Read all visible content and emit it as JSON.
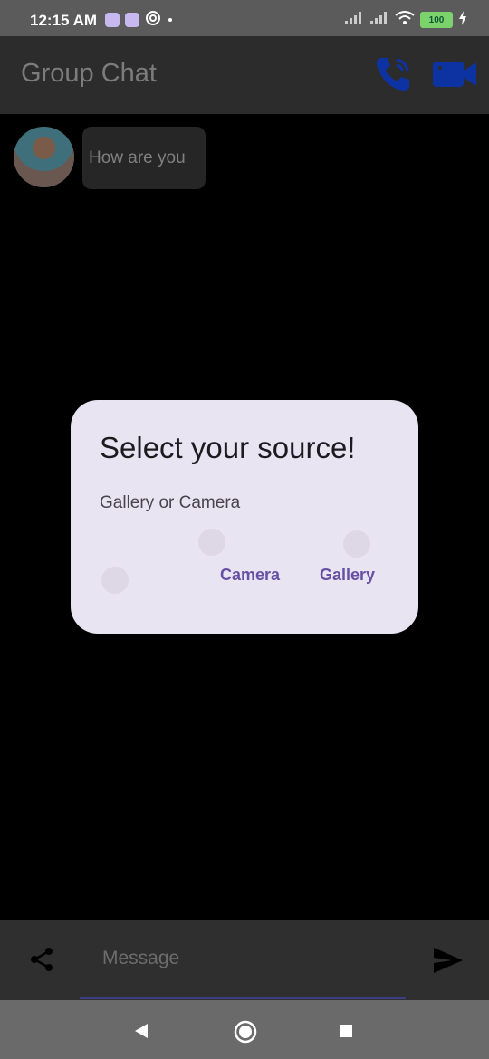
{
  "status_bar": {
    "time": "12:15 AM",
    "battery": "100",
    "left_icons": [
      "app-icon-1",
      "app-icon-2",
      "at-icon",
      "dot-icon"
    ],
    "right_icons": [
      "signal-icon",
      "signal-icon",
      "wifi-icon",
      "battery-icon",
      "charging-icon"
    ]
  },
  "app_bar": {
    "title": "Group Chat",
    "actions": [
      "voice-call-icon",
      "video-call-icon"
    ],
    "accent_color": "#0d33a3"
  },
  "chat": {
    "messages": [
      {
        "text": "How are you",
        "avatar": "user-avatar"
      }
    ]
  },
  "dialog": {
    "title": "Select your source!",
    "message": "Gallery or Camera",
    "buttons": {
      "camera": "Camera",
      "gallery": "Gallery"
    },
    "background_color": "#e9e4f1",
    "button_color": "#6750a4"
  },
  "input_bar": {
    "placeholder": "Message",
    "share_icon": "share-icon",
    "send_icon": "send-icon"
  },
  "nav_bar": {
    "buttons": [
      "back-icon",
      "home-icon",
      "recents-icon"
    ]
  }
}
